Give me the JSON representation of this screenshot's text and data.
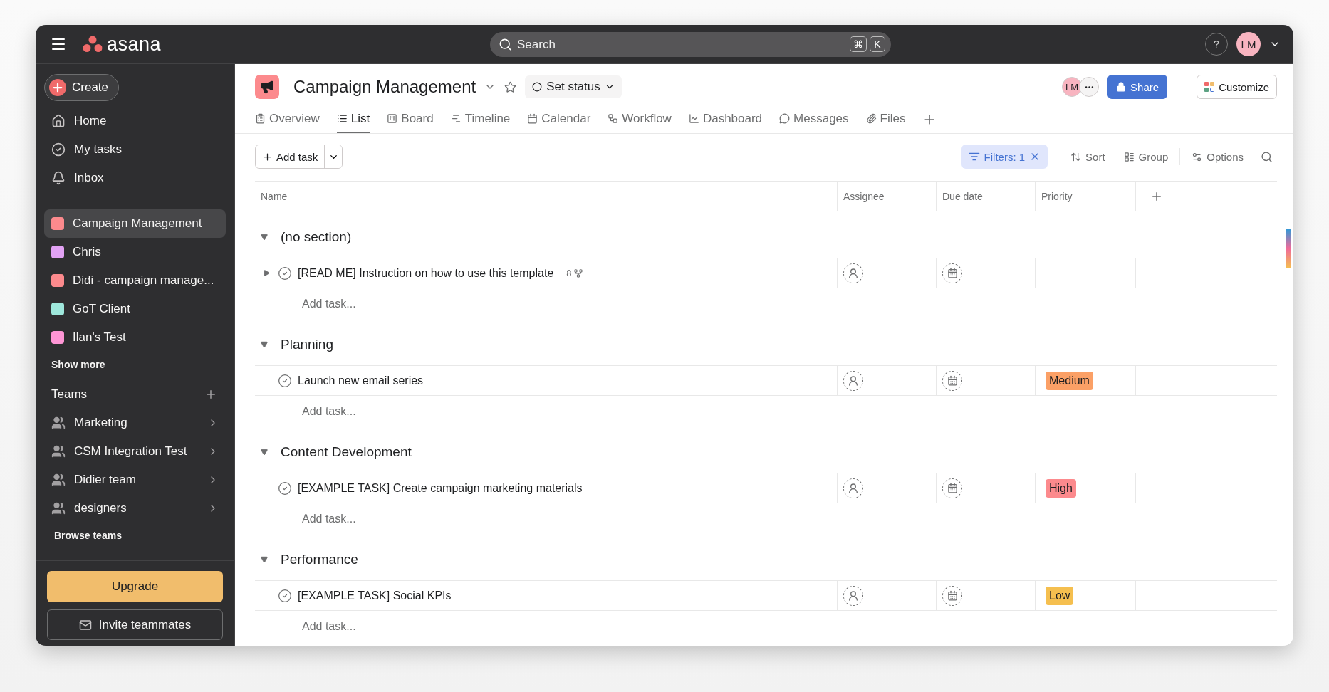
{
  "topbar": {
    "logo_text": "asana",
    "search": {
      "placeholder": "Search"
    },
    "shortcut_keys": [
      "⌘",
      "K"
    ],
    "help": "?",
    "avatar": "LM"
  },
  "sidebar": {
    "create": "Create",
    "nav": [
      {
        "label": "Home",
        "kind": "home",
        "selected": false
      },
      {
        "label": "My tasks",
        "kind": "tasks",
        "selected": false
      },
      {
        "label": "Inbox",
        "kind": "inbox",
        "selected": false
      }
    ],
    "projects": [
      {
        "label": "Campaign Management",
        "color": "#fc8a8d",
        "selected": true
      },
      {
        "label": "Chris",
        "color": "#e2a2f4",
        "selected": false
      },
      {
        "label": "Didi - campaign manage...",
        "color": "#fc8a8d",
        "selected": false
      },
      {
        "label": "GoT Client",
        "color": "#9ee7db",
        "selected": false
      },
      {
        "label": "Ilan's Test",
        "color": "#fe96d5",
        "selected": false
      }
    ],
    "show_more": "Show more",
    "teams_title": "Teams",
    "teams": [
      {
        "label": "Marketing"
      },
      {
        "label": "CSM Integration Test"
      },
      {
        "label": "Didier team"
      },
      {
        "label": "designers"
      }
    ],
    "browse_teams": "Browse teams",
    "upgrade": "Upgrade",
    "invite": "Invite teammates"
  },
  "project": {
    "title": "Campaign Management",
    "status": "Set status",
    "member_avatar": "LM",
    "share": "Share",
    "customize": "Customize",
    "tabs": [
      {
        "label": "Overview",
        "selected": false
      },
      {
        "label": "List",
        "selected": true
      },
      {
        "label": "Board",
        "selected": false
      },
      {
        "label": "Timeline",
        "selected": false
      },
      {
        "label": "Calendar",
        "selected": false
      },
      {
        "label": "Workflow",
        "selected": false
      },
      {
        "label": "Dashboard",
        "selected": false
      },
      {
        "label": "Messages",
        "selected": false
      },
      {
        "label": "Files",
        "selected": false
      }
    ]
  },
  "toolbar": {
    "add_task": "Add task",
    "filters": "Filters: 1",
    "sort": "Sort",
    "group": "Group",
    "options": "Options"
  },
  "table": {
    "columns": [
      "Name",
      "Assignee",
      "Due date",
      "Priority"
    ],
    "sections": [
      {
        "name": "(no section)",
        "expanded": true,
        "add_task": "Add task...",
        "tasks": [
          {
            "name": "[READ ME] Instruction on how to use this template",
            "completed": false,
            "subtasks": {
              "count": "8",
              "expanded": false
            }
          }
        ]
      },
      {
        "name": "Planning",
        "expanded": true,
        "add_task": "Add task...",
        "tasks": [
          {
            "name": "Launch new email series",
            "completed": false,
            "priority": {
              "label": "Medium",
              "color": "#fba066"
            }
          }
        ]
      },
      {
        "name": "Content Development",
        "expanded": true,
        "add_task": "Add task...",
        "tasks": [
          {
            "name": "[EXAMPLE TASK] Create campaign marketing materials",
            "completed": false,
            "priority": {
              "label": "High",
              "color": "#fc8a8d"
            }
          }
        ]
      },
      {
        "name": "Performance",
        "expanded": true,
        "add_task": "Add task...",
        "tasks": [
          {
            "name": "[EXAMPLE TASK] Social KPIs",
            "completed": false,
            "priority": {
              "label": "Low",
              "color": "#f5bf4f"
            }
          }
        ]
      }
    ]
  }
}
